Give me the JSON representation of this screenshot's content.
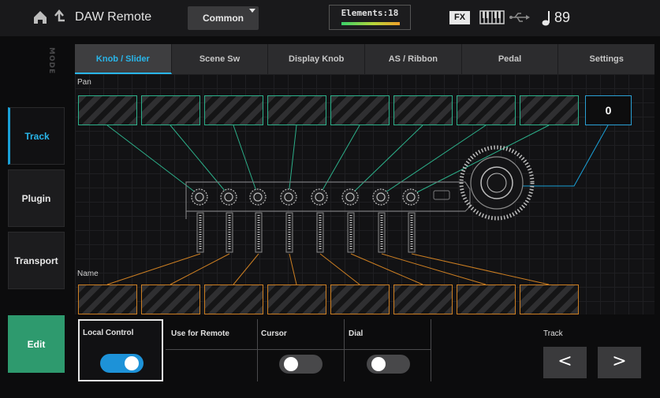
{
  "header": {
    "app_title": "DAW Remote",
    "common_button": "Common",
    "elements_label": "Elements:18",
    "fx_label": "FX",
    "tempo": "89"
  },
  "sidebar": {
    "mode_label": "MODE",
    "items": [
      {
        "label": "Track",
        "active": true
      },
      {
        "label": "Plugin",
        "active": false
      },
      {
        "label": "Transport",
        "active": false
      },
      {
        "label": "Edit",
        "active": false
      }
    ]
  },
  "tabs": [
    {
      "label": "Knob / Slider",
      "active": true
    },
    {
      "label": "Scene Sw",
      "active": false
    },
    {
      "label": "Display Knob",
      "active": false
    },
    {
      "label": "AS / Ribbon",
      "active": false
    },
    {
      "label": "Pedal",
      "active": false
    },
    {
      "label": "Settings",
      "active": false
    }
  ],
  "main": {
    "pan_label": "Pan",
    "pan_value": "0",
    "name_label": "Name"
  },
  "controls": {
    "local_control_label": "Local Control",
    "local_control_on": true,
    "use_for_remote_label": "Use for Remote",
    "cursor_label": "Cursor",
    "cursor_on": false,
    "dial_label": "Dial",
    "dial_on": false,
    "track_label": "Track",
    "prev_symbol": "<",
    "next_symbol": ">"
  },
  "colors": {
    "accent": "#29b6ea",
    "pan_line": "#2cb08a",
    "name_line": "#cd7f22",
    "edit_green": "#2e9a6e"
  }
}
